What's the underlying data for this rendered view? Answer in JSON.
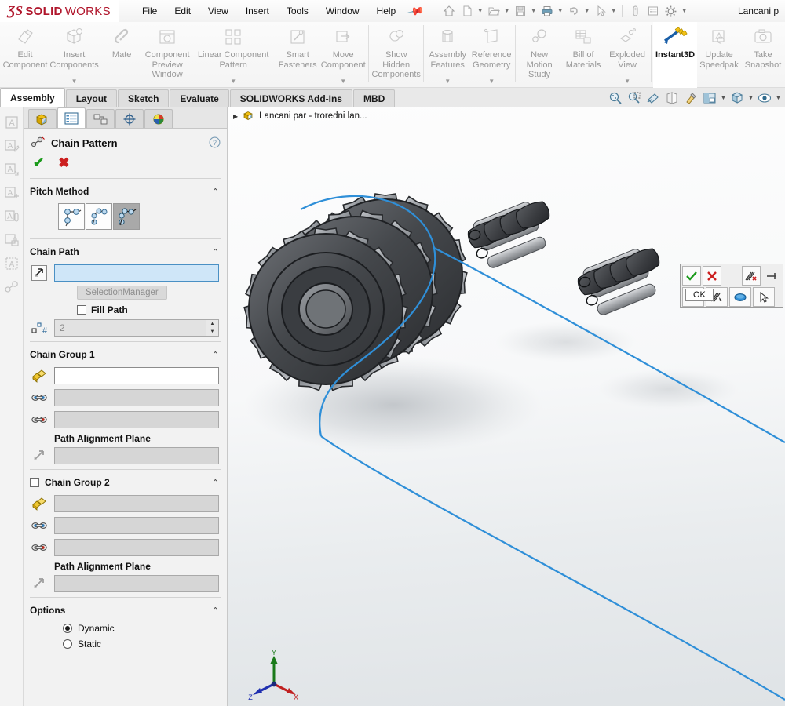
{
  "app": {
    "brand_ds": "ƷS",
    "brand_solid": "SOLID",
    "brand_works": "WORKS",
    "document_title": "Lancani p",
    "accent_red": "#b0152b",
    "accent_blue": "#2f8fd8"
  },
  "menu": {
    "items": [
      "File",
      "Edit",
      "View",
      "Insert",
      "Tools",
      "Window",
      "Help"
    ],
    "pin_icon": "pushpin-icon"
  },
  "quick_access": {
    "buttons": [
      {
        "name": "home-icon",
        "label": "Home"
      },
      {
        "name": "new-document-icon",
        "label": "New"
      },
      {
        "name": "open-folder-icon",
        "label": "Open"
      },
      {
        "name": "save-icon",
        "label": "Save"
      },
      {
        "name": "print-icon",
        "label": "Print"
      },
      {
        "name": "undo-icon",
        "label": "Undo"
      },
      {
        "name": "select-arrow-icon",
        "label": "Select"
      },
      {
        "name": "magnifier-pill-icon",
        "label": "Rebuild"
      },
      {
        "name": "options-list-icon",
        "label": "Options List"
      },
      {
        "name": "gear-icon",
        "label": "Options"
      }
    ]
  },
  "ribbon": {
    "buttons": [
      {
        "label": "Edit\nComponent",
        "icon": "edit-component-icon",
        "caret": false,
        "enabled": false
      },
      {
        "label": "Insert\nComponents",
        "icon": "insert-components-icon",
        "caret": true,
        "enabled": false
      },
      {
        "label": "Mate",
        "icon": "mate-icon",
        "caret": false,
        "enabled": false
      },
      {
        "label": "Component\nPreview\nWindow",
        "icon": "component-preview-window-icon",
        "caret": false,
        "enabled": false
      },
      {
        "label": "Linear Component\nPattern",
        "icon": "linear-component-pattern-icon",
        "caret": true,
        "enabled": false
      },
      {
        "label": "Smart\nFasteners",
        "icon": "smart-fasteners-icon",
        "caret": false,
        "enabled": false
      },
      {
        "label": "Move\nComponent",
        "icon": "move-component-icon",
        "caret": true,
        "enabled": false
      },
      {
        "label": "Show\nHidden\nComponents",
        "icon": "show-hidden-components-icon",
        "caret": false,
        "enabled": false
      },
      {
        "label": "Assembly\nFeatures",
        "icon": "assembly-features-icon",
        "caret": true,
        "enabled": false
      },
      {
        "label": "Reference\nGeometry",
        "icon": "reference-geometry-icon",
        "caret": true,
        "enabled": false
      },
      {
        "label": "New\nMotion\nStudy",
        "icon": "new-motion-study-icon",
        "caret": false,
        "enabled": false
      },
      {
        "label": "Bill of\nMaterials",
        "icon": "bill-of-materials-icon",
        "caret": false,
        "enabled": false
      },
      {
        "label": "Exploded\nView",
        "icon": "exploded-view-icon",
        "caret": true,
        "enabled": false
      },
      {
        "label": "Instant3D",
        "icon": "instant3d-icon",
        "caret": false,
        "enabled": true
      },
      {
        "label": "Update\nSpeedpak",
        "icon": "update-speedpak-icon",
        "caret": false,
        "enabled": false
      },
      {
        "label": "Take\nSnapshot",
        "icon": "take-snapshot-icon",
        "caret": false,
        "enabled": false
      }
    ]
  },
  "command_tabs": {
    "tabs": [
      "Assembly",
      "Layout",
      "Sketch",
      "Evaluate",
      "SOLIDWORKS Add-Ins",
      "MBD"
    ],
    "selected": "Assembly"
  },
  "view_toolbar": {
    "buttons": [
      {
        "name": "zoom-to-fit-icon",
        "caret": false
      },
      {
        "name": "zoom-to-area-icon",
        "caret": false
      },
      {
        "name": "section-view-icon",
        "caret": false
      },
      {
        "name": "view-orientation-icon",
        "caret": false
      },
      {
        "name": "edit-appearance-icon",
        "caret": false
      },
      {
        "name": "apply-scene-icon",
        "caret": true
      },
      {
        "name": "display-style-icon",
        "caret": true
      },
      {
        "name": "hide-show-items-icon",
        "caret": true
      }
    ]
  },
  "left_strip": {
    "icons": [
      "annotation-note-icon",
      "annotation-edit-icon",
      "annotation-move-icon",
      "annotation-add-icon",
      "annotation-link-icon",
      "annotation-lock-icon",
      "annotation-pattern-icon",
      "chain-pattern-icon"
    ]
  },
  "property_manager": {
    "tabs": [
      {
        "name": "feature-manager-tab",
        "icon": "assembly-tree-icon",
        "selected": false
      },
      {
        "name": "property-manager-tab",
        "icon": "property-list-icon",
        "selected": true
      },
      {
        "name": "configuration-manager-tab",
        "icon": "configuration-icon",
        "selected": false
      },
      {
        "name": "dimxpert-manager-tab",
        "icon": "dimxpert-target-icon",
        "selected": false
      },
      {
        "name": "display-manager-tab",
        "icon": "display-sphere-icon",
        "selected": false
      }
    ],
    "title": "Chain Pattern",
    "title_icon": "chain-pattern-icon",
    "help_icon": "help-question-icon",
    "ok_icon": "green-check-icon",
    "cancel_icon": "red-x-icon",
    "sections": {
      "pitch_method": {
        "title": "Pitch Method",
        "chevron": "⌃",
        "options": [
          {
            "name": "pitch-method-distance",
            "selected": false
          },
          {
            "name": "pitch-method-component-linkage",
            "selected": false
          },
          {
            "name": "pitch-method-connected-linkage",
            "selected": true
          }
        ]
      },
      "chain_path": {
        "title": "Chain Path",
        "chevron": "⌃",
        "path_icon": "path-selection-icon",
        "path_value": "",
        "selection_manager_label": "SelectionManager",
        "fill_path_label": "Fill Path",
        "fill_path_checked": false,
        "instances_icon": "number-of-instances-icon",
        "instances_value": "2"
      },
      "chain_group_1": {
        "title": "Chain Group 1",
        "chevron": "⌃",
        "rows": [
          {
            "name": "components-to-pattern-field",
            "icon": "components-yellow-icon",
            "value": "",
            "state": "active-white"
          },
          {
            "name": "path-mate-1-field",
            "icon": "chain-link-blue-icon",
            "value": "",
            "state": "disabled"
          },
          {
            "name": "path-mate-2-field",
            "icon": "chain-link-red-icon",
            "value": "",
            "state": "disabled"
          }
        ],
        "alignment_label": "Path Alignment Plane",
        "alignment_icon": "alignment-plane-icon",
        "alignment_value": ""
      },
      "chain_group_2": {
        "title": "Chain Group 2",
        "chevron": "⌃",
        "checked": false,
        "rows": [
          {
            "name": "components-to-pattern-field-2",
            "icon": "components-yellow-icon",
            "value": "",
            "state": "disabled"
          },
          {
            "name": "path-mate-1-field-2",
            "icon": "chain-link-blue-icon",
            "value": "",
            "state": "disabled"
          },
          {
            "name": "path-mate-2-field-2",
            "icon": "chain-link-red-icon",
            "value": "",
            "state": "disabled"
          }
        ],
        "alignment_label": "Path Alignment Plane",
        "alignment_icon": "alignment-plane-icon",
        "alignment_value": ""
      },
      "options": {
        "title": "Options",
        "chevron": "⌃",
        "radios": [
          {
            "label": "Dynamic",
            "selected": true
          },
          {
            "label": "Static",
            "selected": false
          }
        ]
      }
    }
  },
  "graphics": {
    "tree_item": "Lancani par - troredni lan...",
    "tree_item_icon": "assembly-icon",
    "tree_arrow": "▶",
    "triad": {
      "x_label": "X",
      "y_label": "Y",
      "z_label": "Z"
    },
    "context_toolbar": {
      "tooltip": "OK",
      "buttons": [
        {
          "name": "confirm-ok-icon",
          "row": 1
        },
        {
          "name": "cancel-x-icon",
          "row": 1
        },
        {
          "name": "delete-path-icon",
          "row": 1
        },
        {
          "name": "pin-toolbar-icon",
          "row": 1
        },
        {
          "name": "select-partial-loop-icon",
          "row": 2
        },
        {
          "name": "select-loop-icon",
          "row": 2
        },
        {
          "name": "select-closed-loop-icon",
          "row": 2
        },
        {
          "name": "select-arrow-icon",
          "row": 2
        }
      ]
    }
  }
}
